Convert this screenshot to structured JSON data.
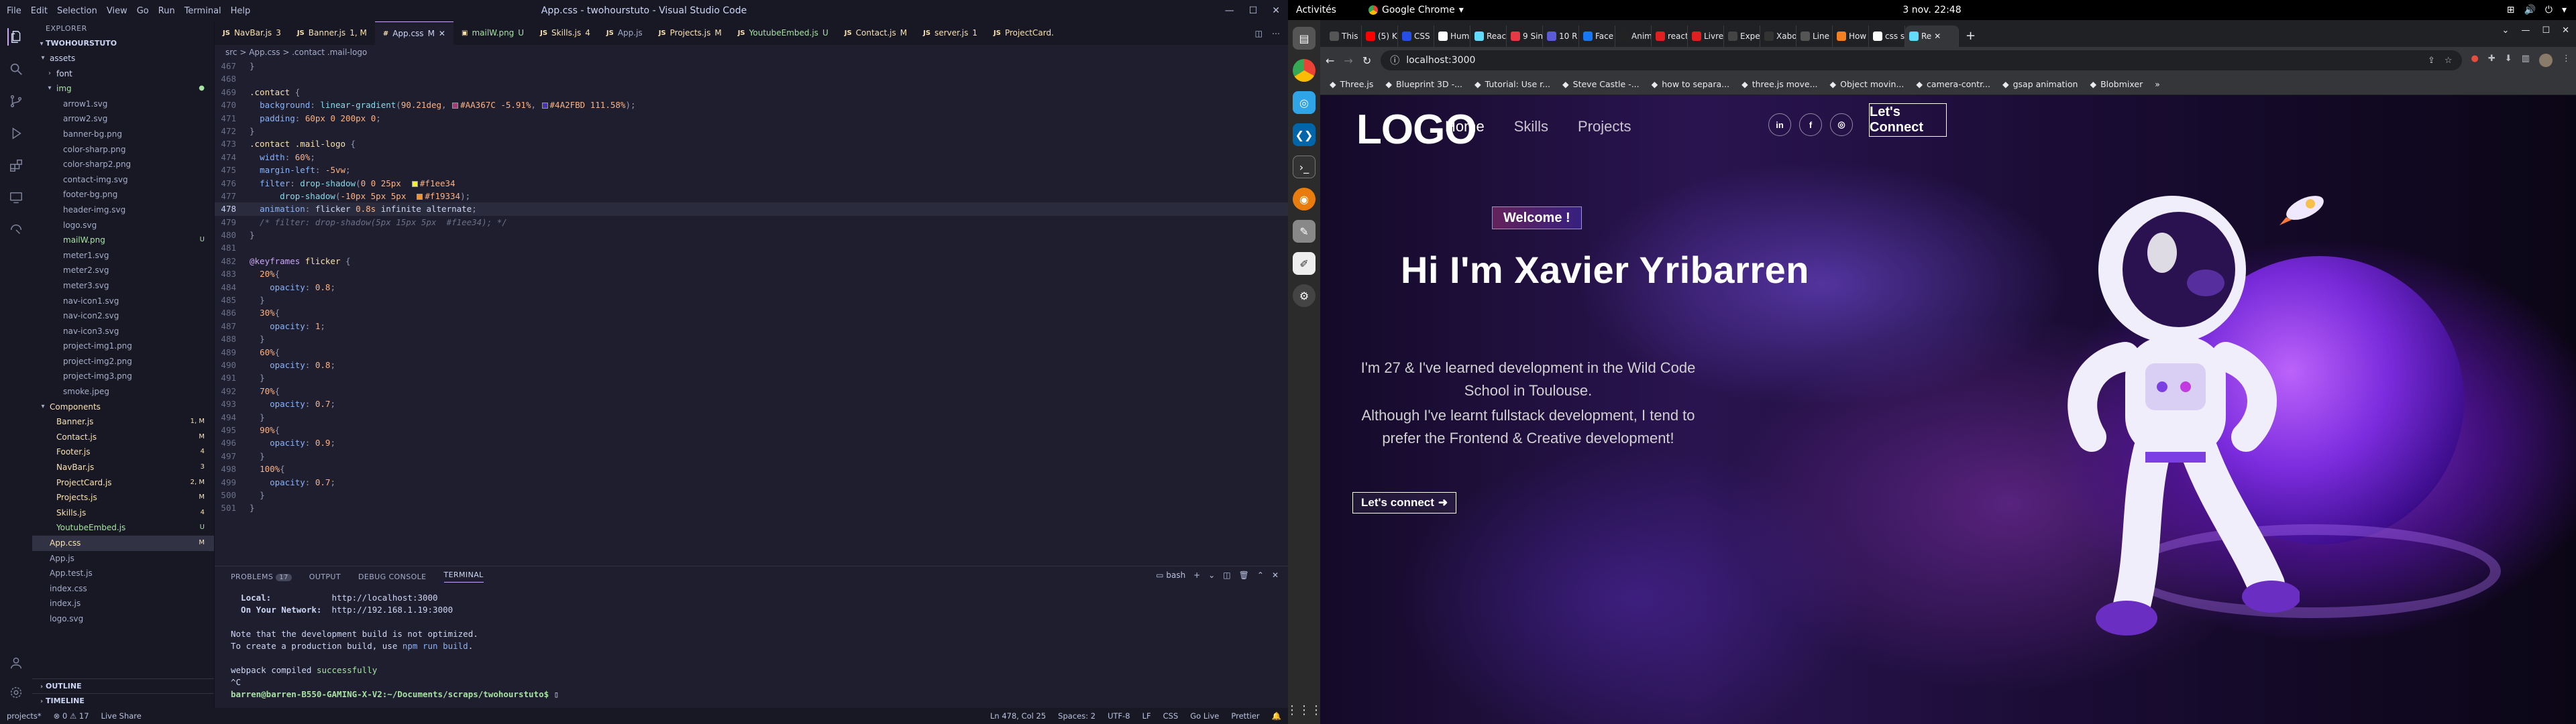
{
  "vscode": {
    "menu": [
      "File",
      "Edit",
      "Selection",
      "View",
      "Go",
      "Run",
      "Terminal",
      "Help"
    ],
    "window_title": "App.css - twohourstuto - Visual Studio Code",
    "explorer": {
      "header": "EXPLORER",
      "root": "TWOHOURSTUTO",
      "rows": [
        {
          "label": "assets",
          "kind": "folder-open",
          "indent": 1,
          "color": "c-text"
        },
        {
          "label": "font",
          "kind": "folder",
          "indent": 2,
          "color": "c-text"
        },
        {
          "label": "img",
          "kind": "folder-open",
          "indent": 2,
          "color": "c-green",
          "badge": ""
        },
        {
          "label": "arrow1.svg",
          "kind": "file",
          "indent": 3,
          "color": "c-sub"
        },
        {
          "label": "arrow2.svg",
          "kind": "file",
          "indent": 3,
          "color": "c-sub"
        },
        {
          "label": "banner-bg.png",
          "kind": "file",
          "indent": 3,
          "color": "c-sub"
        },
        {
          "label": "color-sharp.png",
          "kind": "file",
          "indent": 3,
          "color": "c-sub"
        },
        {
          "label": "color-sharp2.png",
          "kind": "file",
          "indent": 3,
          "color": "c-sub"
        },
        {
          "label": "contact-img.svg",
          "kind": "file",
          "indent": 3,
          "color": "c-sub"
        },
        {
          "label": "footer-bg.png",
          "kind": "file",
          "indent": 3,
          "color": "c-sub"
        },
        {
          "label": "header-img.svg",
          "kind": "file",
          "indent": 3,
          "color": "c-sub"
        },
        {
          "label": "logo.svg",
          "kind": "file",
          "indent": 3,
          "color": "c-sub"
        },
        {
          "label": "mailW.png",
          "kind": "file",
          "indent": 3,
          "color": "c-green",
          "badge": "U"
        },
        {
          "label": "meter1.svg",
          "kind": "file",
          "indent": 3,
          "color": "c-sub"
        },
        {
          "label": "meter2.svg",
          "kind": "file",
          "indent": 3,
          "color": "c-sub"
        },
        {
          "label": "meter3.svg",
          "kind": "file",
          "indent": 3,
          "color": "c-sub"
        },
        {
          "label": "nav-icon1.svg",
          "kind": "file",
          "indent": 3,
          "color": "c-sub"
        },
        {
          "label": "nav-icon2.svg",
          "kind": "file",
          "indent": 3,
          "color": "c-sub"
        },
        {
          "label": "nav-icon3.svg",
          "kind": "file",
          "indent": 3,
          "color": "c-sub"
        },
        {
          "label": "project-img1.png",
          "kind": "file",
          "indent": 3,
          "color": "c-sub"
        },
        {
          "label": "project-img2.png",
          "kind": "file",
          "indent": 3,
          "color": "c-sub"
        },
        {
          "label": "project-img3.png",
          "kind": "file",
          "indent": 3,
          "color": "c-sub"
        },
        {
          "label": "smoke.jpeg",
          "kind": "file",
          "indent": 3,
          "color": "c-sub"
        },
        {
          "label": "Components",
          "kind": "folder-open",
          "indent": 1,
          "color": "c-yellow"
        },
        {
          "label": "Banner.js",
          "kind": "file",
          "indent": 2,
          "color": "c-yellow",
          "badge": "1, M"
        },
        {
          "label": "Contact.js",
          "kind": "file",
          "indent": 2,
          "color": "c-yellow",
          "badge": "M"
        },
        {
          "label": "Footer.js",
          "kind": "file",
          "indent": 2,
          "color": "c-yellow",
          "badge": "4"
        },
        {
          "label": "NavBar.js",
          "kind": "file",
          "indent": 2,
          "color": "c-yellow",
          "badge": "3"
        },
        {
          "label": "ProjectCard.js",
          "kind": "file",
          "indent": 2,
          "color": "c-yellow",
          "badge": "2, M"
        },
        {
          "label": "Projects.js",
          "kind": "file",
          "indent": 2,
          "color": "c-yellow",
          "badge": "M"
        },
        {
          "label": "Skills.js",
          "kind": "file",
          "indent": 2,
          "color": "c-yellow",
          "badge": "4"
        },
        {
          "label": "YoutubeEmbed.js",
          "kind": "file",
          "indent": 2,
          "color": "c-green",
          "badge": "U"
        },
        {
          "label": "App.css",
          "kind": "file",
          "indent": 1,
          "color": "c-yellow",
          "badge": "M",
          "selected": true
        },
        {
          "label": "App.js",
          "kind": "file",
          "indent": 1,
          "color": "c-sub"
        },
        {
          "label": "App.test.js",
          "kind": "file",
          "indent": 1,
          "color": "c-sub"
        },
        {
          "label": "index.css",
          "kind": "file",
          "indent": 1,
          "color": "c-sub"
        },
        {
          "label": "index.js",
          "kind": "file",
          "indent": 1,
          "color": "c-sub"
        },
        {
          "label": "logo.svg",
          "kind": "file",
          "indent": 1,
          "color": "c-sub"
        }
      ],
      "outline": "OUTLINE",
      "timeline": "TIMELINE"
    },
    "tabs": [
      {
        "label": "NavBar.js",
        "badge": "3",
        "color": "c-yellow"
      },
      {
        "label": "Banner.js",
        "badge": "1, M",
        "color": "c-yellow"
      },
      {
        "label": "App.css",
        "badge": "M",
        "color": "c-text",
        "active": true
      },
      {
        "label": "mailW.png",
        "badge": "U",
        "color": "c-green"
      },
      {
        "label": "Skills.js",
        "badge": "4",
        "color": "c-yellow"
      },
      {
        "label": "App.js",
        "badge": "",
        "color": "c-sub"
      },
      {
        "label": "Projects.js",
        "badge": "M",
        "color": "c-yellow"
      },
      {
        "label": "YoutubeEmbed.js",
        "badge": "U",
        "color": "c-green"
      },
      {
        "label": "Contact.js",
        "badge": "M",
        "color": "c-yellow"
      },
      {
        "label": "server.js",
        "badge": "1",
        "color": "c-yellow"
      },
      {
        "label": "ProjectCard.",
        "badge": "",
        "color": "c-yellow"
      }
    ],
    "breadcrumb": "src  >  App.css  >  .contact .mail-logo",
    "code": [
      {
        "n": "467",
        "t": "}"
      },
      {
        "n": "468",
        "t": ""
      },
      {
        "n": "469",
        "t": ".contact {"
      },
      {
        "n": "470",
        "t": "  background: linear-gradient(90.21deg, [#AA367C] -5.91%, [#4A2FBD] 111.58%);"
      },
      {
        "n": "471",
        "t": "  padding: 60px 0 200px 0;"
      },
      {
        "n": "472",
        "t": "}"
      },
      {
        "n": "473",
        "t": ".contact .mail-logo {"
      },
      {
        "n": "474",
        "t": "  width: 60%;"
      },
      {
        "n": "475",
        "t": "  margin-left: -5vw;"
      },
      {
        "n": "476",
        "t": "  filter: drop-shadow(0 0 25px  [#f1ee34]"
      },
      {
        "n": "477",
        "t": "      drop-shadow(-10px 5px 5px  [#f19334]);"
      },
      {
        "n": "478",
        "t": "  animation: flicker 0.8s infinite alternate;",
        "cur": true
      },
      {
        "n": "479",
        "t": "  /* filter: drop-shadow(5px 15px 5px  #f1ee34); */"
      },
      {
        "n": "480",
        "t": "}"
      },
      {
        "n": "481",
        "t": ""
      },
      {
        "n": "482",
        "t": "@keyframes flicker {"
      },
      {
        "n": "483",
        "t": "  20%{"
      },
      {
        "n": "484",
        "t": "    opacity: 0.8;"
      },
      {
        "n": "485",
        "t": "  }"
      },
      {
        "n": "486",
        "t": "  30%{"
      },
      {
        "n": "487",
        "t": "    opacity: 1;"
      },
      {
        "n": "488",
        "t": "  }"
      },
      {
        "n": "489",
        "t": "  60%{"
      },
      {
        "n": "490",
        "t": "    opacity: 0.8;"
      },
      {
        "n": "491",
        "t": "  }"
      },
      {
        "n": "492",
        "t": "  70%{"
      },
      {
        "n": "493",
        "t": "    opacity: 0.7;"
      },
      {
        "n": "494",
        "t": "  }"
      },
      {
        "n": "495",
        "t": "  90%{"
      },
      {
        "n": "496",
        "t": "    opacity: 0.9;"
      },
      {
        "n": "497",
        "t": "  }"
      },
      {
        "n": "498",
        "t": "  100%{"
      },
      {
        "n": "499",
        "t": "    opacity: 0.7;"
      },
      {
        "n": "500",
        "t": "  }"
      },
      {
        "n": "501",
        "t": "}"
      }
    ],
    "panel": {
      "tabs": [
        "PROBLEMS",
        "OUTPUT",
        "DEBUG CONSOLE",
        "TERMINAL"
      ],
      "problems_count": "17",
      "shell": "bash",
      "terminal": {
        "local_label": "  Local:",
        "local_url": "http://localhost:3000",
        "network_label": "  On Your Network:",
        "network_url": "http://192.168.1.19:3000",
        "note1": "Note that the development build is not optimized.",
        "note2_pre": "To create a production build, use ",
        "note2_cmd": "npm run build",
        "note2_post": ".",
        "compiled_pre": "webpack compiled ",
        "compiled_word": "successfully",
        "ctrlc": "^C",
        "prompt": "barren@barren-B550-GAMING-X-V2:~/Documents/scraps/twohourstuto$ "
      }
    },
    "status": {
      "left": [
        "projects*",
        "⊗ 0  ⚠ 17",
        "Live Share"
      ],
      "right": [
        "Ln 478, Col 25",
        "Spaces: 2",
        "UTF-8",
        "LF",
        "CSS",
        "Go Live",
        "Prettier"
      ]
    }
  },
  "desktop": {
    "activities": "Activités",
    "app_name": "Google Chrome",
    "clock": "3 nov.  22:48"
  },
  "chrome": {
    "tabs": [
      {
        "label": "This",
        "fav": "#555555"
      },
      {
        "label": "(5) K",
        "fav": "#ff0000"
      },
      {
        "label": "CSS",
        "fav": "#264de4"
      },
      {
        "label": "Hum",
        "fav": "#ffffff"
      },
      {
        "label": "Reac",
        "fav": "#61dafb"
      },
      {
        "label": "9 Sin",
        "fav": "#e63946"
      },
      {
        "label": "10 R",
        "fav": "#5b5bd6"
      },
      {
        "label": "Face",
        "fav": "#1877f2"
      },
      {
        "label": "Anim",
        "fav": "#222222"
      },
      {
        "label": "react",
        "fav": "#e02020"
      },
      {
        "label": "Livre",
        "fav": "#e02020"
      },
      {
        "label": "Expe",
        "fav": "#444444"
      },
      {
        "label": "Xabo",
        "fav": "#333333"
      },
      {
        "label": "Line",
        "fav": "#555555"
      },
      {
        "label": "How",
        "fav": "#f48024"
      },
      {
        "label": "css s",
        "fav": "#ffffff"
      },
      {
        "label": "Re",
        "fav": "#61dafb",
        "active": true
      }
    ],
    "url": "localhost:3000",
    "bookmarks": [
      "Three.js",
      "Blueprint 3D -...",
      "Tutorial: Use r...",
      "Steve Castle -...",
      "how to separa...",
      "three.js move...",
      "Object movin...",
      "camera-contr...",
      "gsap animation",
      "Blobmixer"
    ]
  },
  "site": {
    "logo": "LOGO",
    "nav": [
      "Home",
      "Skills",
      "Projects"
    ],
    "social": [
      "in",
      "f",
      "◎"
    ],
    "connect": "Let's Connect",
    "welcome": "Welcome !",
    "title": "Hi I'm Xavier Yribarren",
    "p1": "I'm 27 & I've learned development in the Wild Code School in Toulouse.",
    "p2": "Although I've learnt fullstack development, I tend to prefer the Frontend & Creative development!",
    "cta": "Let's connect"
  }
}
